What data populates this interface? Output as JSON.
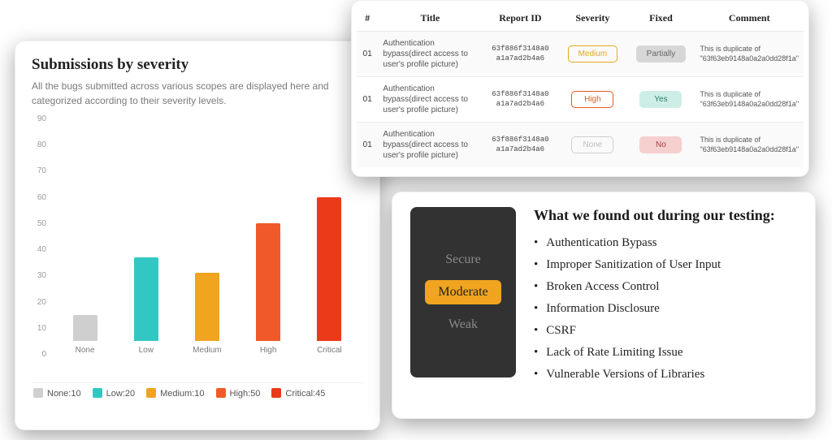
{
  "chart_card": {
    "title": "Submissions by severity",
    "subtitle": "All the bugs submitted across various scopes are displayed here and categorized according to their severity levels."
  },
  "chart_data": {
    "type": "bar",
    "title": "Submissions by severity",
    "xlabel": "",
    "ylabel": "",
    "ylim": [
      0,
      90
    ],
    "yticks": [
      0,
      10,
      20,
      30,
      40,
      50,
      60,
      70,
      80,
      90
    ],
    "categories": [
      "None",
      "Low",
      "Medium",
      "High",
      "Critical"
    ],
    "values": [
      10,
      32,
      26,
      45,
      55
    ],
    "colors": [
      "#cfcfcf",
      "#33c7c4",
      "#f0a41f",
      "#f05a28",
      "#ea3a1a"
    ],
    "legend_values": [
      10,
      20,
      10,
      50,
      45
    ]
  },
  "table": {
    "headers": [
      "#",
      "Title",
      "Report ID",
      "Severity",
      "Fixed",
      "Comment"
    ],
    "rows": [
      {
        "idx": "01",
        "title": "Authentication bypass(direct access to user's profile picture)",
        "report_id": "63f886f3148a0a1a7ad2b4a6",
        "severity": "Medium",
        "sev_class": "sev-medium",
        "fixed": "Partially",
        "fix_class": "fix-partial",
        "comment": "This is duplicate of \"63f63eb9148a0a2a0dd28f1a\""
      },
      {
        "idx": "01",
        "title": "Authentication bypass(direct access to user's profile picture)",
        "report_id": "63f886f3148a0a1a7ad2b4a6",
        "severity": "High",
        "sev_class": "sev-high",
        "fixed": "Yes",
        "fix_class": "fix-yes",
        "comment": "This is duplicate of \"63f63eb9148a0a2a0dd28f1a\""
      },
      {
        "idx": "01",
        "title": "Authentication bypass(direct access to user's profile picture)",
        "report_id": "63f886f3148a0a1a7ad2b4a6",
        "severity": "None",
        "sev_class": "sev-none",
        "fixed": "No",
        "fix_class": "fix-no",
        "comment": "This is duplicate of \"63f63eb9148a0a2a0dd28f1a\""
      }
    ]
  },
  "findings": {
    "gauge": {
      "top": "Secure",
      "mid": "Moderate",
      "bot": "Weak"
    },
    "title": "What we found out during our testing:",
    "items": [
      "Authentication Bypass",
      "Improper Sanitization of User Input",
      "Broken Access Control",
      "Information Disclosure",
      "CSRF",
      "Lack of Rate Limiting Issue",
      "Vulnerable Versions of  Libraries"
    ]
  }
}
